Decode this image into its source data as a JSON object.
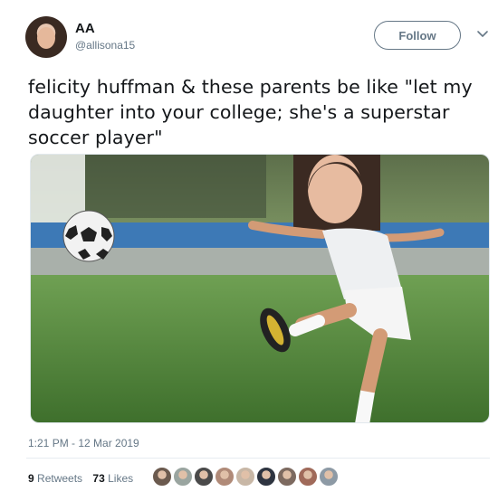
{
  "user": {
    "name": "AA",
    "handle": "@allisona15",
    "avatar_icon": "profile-photo"
  },
  "follow_button": {
    "label": "Follow"
  },
  "menu": {
    "icon": "chevron-down-icon"
  },
  "tweet": {
    "text": "felicity huffman & these parents be like \"let my daughter into your college; she's a superstar soccer player\"",
    "media_icon": "meme-photo"
  },
  "timestamp": "1:21 PM - 12 Mar 2019",
  "stats": {
    "retweets_count": "9",
    "retweets_label": "Retweets",
    "likes_count": "73",
    "likes_label": "Likes"
  },
  "likers": {
    "colors": [
      "#6b5a4e",
      "#9aa5a0",
      "#4a4a4a",
      "#b08a78",
      "#c8b7a6",
      "#2e3440",
      "#7d6a60",
      "#a06a5a",
      "#8d9aa5"
    ]
  }
}
